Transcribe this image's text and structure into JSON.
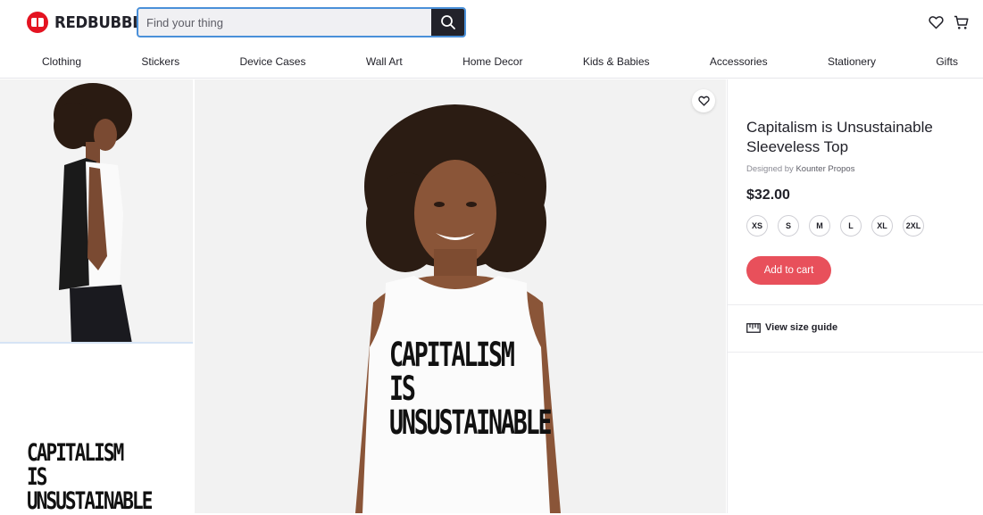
{
  "header": {
    "logo_text": "REDBUBBLE",
    "search_placeholder": "Find your thing",
    "icons": [
      "search-icon",
      "heart-icon",
      "cart-icon"
    ]
  },
  "nav": {
    "items": [
      "Clothing",
      "Stickers",
      "Device Cases",
      "Wall Art",
      "Home Decor",
      "Kids & Babies",
      "Accessories",
      "Stationery",
      "Gifts"
    ]
  },
  "product": {
    "title": "Capitalism is Unsustainable Sleeveless Top",
    "designer_prefix": "Designed by",
    "designer_name": "Kounter Propos",
    "price": "$32.00",
    "sizes": [
      "XS",
      "S",
      "M",
      "L",
      "XL",
      "2XL"
    ],
    "add_to_cart_label": "Add to cart",
    "size_guide_label": "View size guide",
    "print_text_line1": "CAPITALISM IS",
    "print_text_line2": "UNSUSTAINABLE"
  },
  "colors": {
    "brand_red": "#e41321",
    "cart_button": "#e8505b",
    "search_border": "#4a90d9",
    "search_button": "#22222a"
  }
}
